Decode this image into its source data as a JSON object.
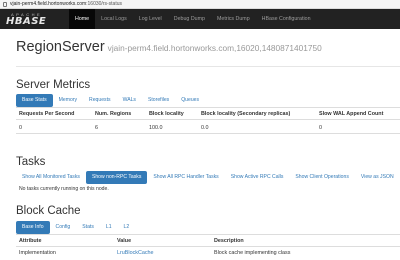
{
  "browser": {
    "url_host": "vjain-perm4.field.hortonworks.com",
    "url_path": ":16030/rs-status"
  },
  "navbar": {
    "logo_top": "APACHE",
    "logo_main": "HBASE",
    "items": [
      {
        "label": "Home",
        "active": true
      },
      {
        "label": "Local Logs",
        "active": false
      },
      {
        "label": "Log Level",
        "active": false
      },
      {
        "label": "Debug Dump",
        "active": false
      },
      {
        "label": "Metrics Dump",
        "active": false
      },
      {
        "label": "HBase Configuration",
        "active": false
      }
    ]
  },
  "header": {
    "title": "RegionServer",
    "subtitle": "vjain-perm4.field.hortonworks.com,16020,1480871401750"
  },
  "server_metrics": {
    "title": "Server Metrics",
    "tabs": [
      "Base Stats",
      "Memory",
      "Requests",
      "WALs",
      "Storefiles",
      "Queues"
    ],
    "columns": [
      "Requests Per Second",
      "Num. Regions",
      "Block locality",
      "Block locality (Secondary replicas)",
      "Slow WAL Append Count"
    ],
    "row": [
      "0",
      "6",
      "100.0",
      "0.0",
      "0"
    ]
  },
  "tasks": {
    "title": "Tasks",
    "tabs": [
      "Show All Monitored Tasks",
      "Show non-RPC Tasks",
      "Show All RPC Handler Tasks",
      "Show Active RPC Calls",
      "Show Client Operations",
      "View as JSON"
    ],
    "note": "No tasks currently running on this node."
  },
  "block_cache": {
    "title": "Block Cache",
    "tabs": [
      "Base Info",
      "Config",
      "Stats",
      "L1",
      "L2"
    ],
    "columns": [
      "Attribute",
      "Value",
      "Description"
    ],
    "row": [
      "Implementation",
      "LruBlockCache",
      "Block cache implementing class"
    ]
  }
}
